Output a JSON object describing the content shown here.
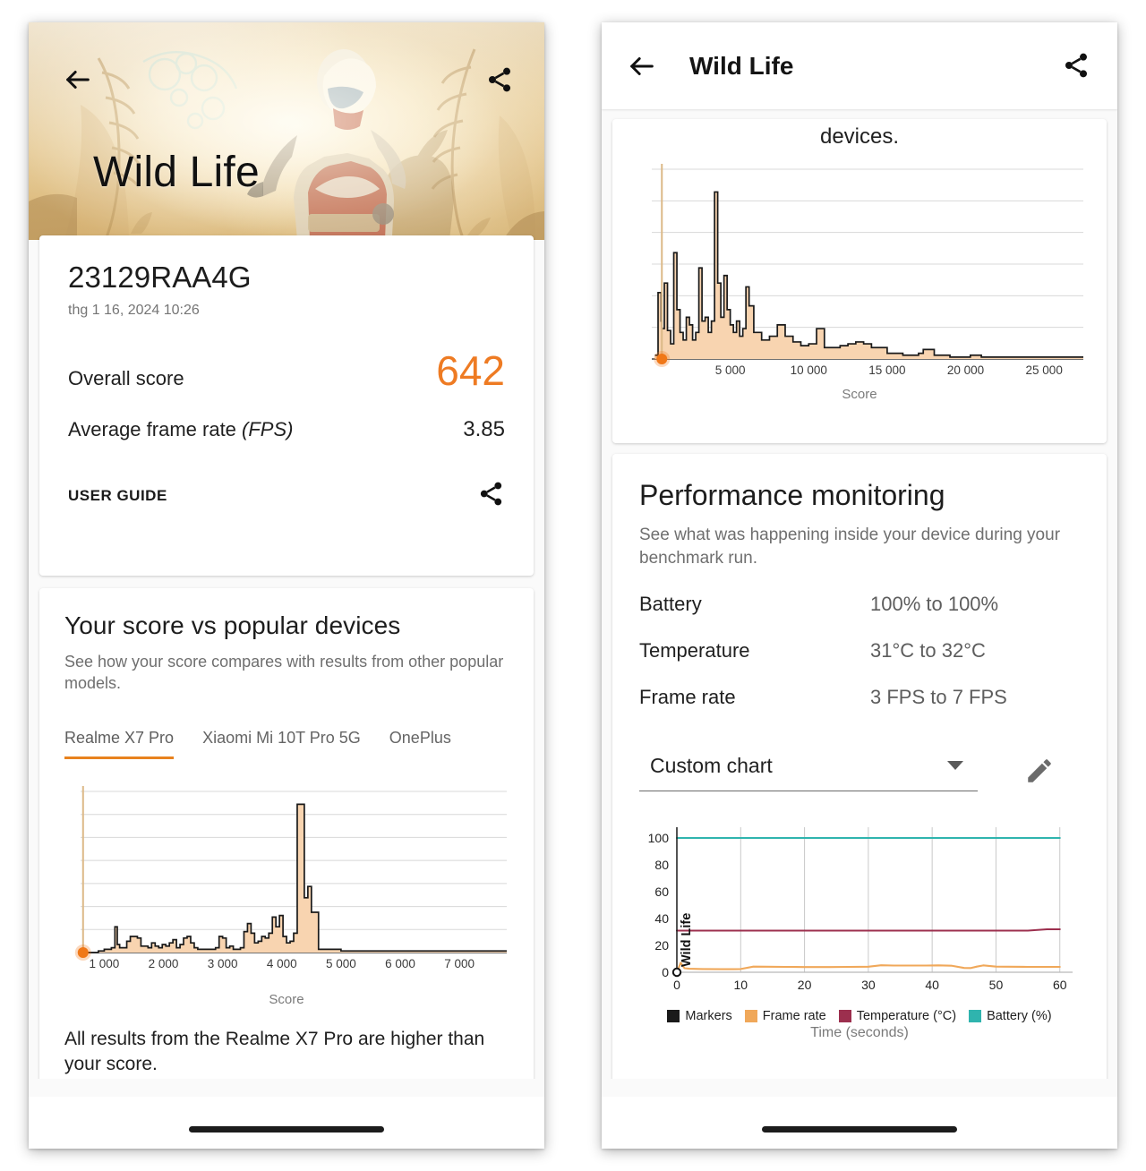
{
  "left_panel": {
    "hero": {
      "title": "Wild Life",
      "back_icon": "arrow-left-icon",
      "share_icon": "share-icon"
    },
    "score_card": {
      "device_name": "23129RAA4G",
      "timestamp": "thg 1 16, 2024 10:26",
      "overall_score_label": "Overall score",
      "overall_score_value": "642",
      "frame_rate_label_main": "Average frame rate ",
      "frame_rate_label_unit": "(FPS)",
      "frame_rate_value": "3.85",
      "user_guide_label": "USER GUIDE",
      "share_icon": "share-icon",
      "accent_color": "#ee7b23"
    },
    "compare_card": {
      "title": "Your score vs popular devices",
      "subtitle": "See how your score compares with results from other popular models.",
      "tabs": [
        {
          "label": "Realme X7 Pro",
          "active": true
        },
        {
          "label": "Xiaomi Mi 10T Pro 5G",
          "active": false
        },
        {
          "label": "OnePlus",
          "active": false
        }
      ],
      "note": "All results from the Realme X7 Pro are higher than your score."
    }
  },
  "right_panel": {
    "appbar": {
      "title": "Wild Life",
      "back_icon": "arrow-left-icon",
      "share_icon": "share-icon"
    },
    "clipped_text": "devices.",
    "performance": {
      "title": "Performance monitoring",
      "subtitle": "See what was happening inside your device during your benchmark run.",
      "rows": [
        {
          "key": "Battery",
          "value": "100% to 100%"
        },
        {
          "key": "Temperature",
          "value": "31°C to 32°C"
        },
        {
          "key": "Frame rate",
          "value": "3 FPS to 7 FPS"
        }
      ],
      "chart_select_value": "Custom chart",
      "chart_select_icon": "chevron-down-icon",
      "edit_icon": "pencil-icon"
    }
  },
  "chart_data": [
    {
      "id": "left-histogram",
      "type": "area",
      "title": "",
      "xlabel": "Score",
      "ylabel": "",
      "xlim": [
        600,
        7800
      ],
      "ylim": [
        0,
        100
      ],
      "xticks": [
        1000,
        2000,
        3000,
        4000,
        5000,
        6000,
        7000
      ],
      "xticklabels": [
        "1 000",
        "2 000",
        "3 000",
        "4 000",
        "5 000",
        "6 000",
        "7 000"
      ],
      "grid": "horizontal",
      "gridline_count": 7,
      "line_color": "#1a1a1a",
      "fill_color": "#f8d4b0",
      "marker": {
        "x": 642,
        "y": 0,
        "color": "#f07818",
        "label": "your score"
      },
      "marker_line_color": "#dcb988",
      "x": [
        640,
        700,
        800,
        900,
        1000,
        1060,
        1120,
        1180,
        1220,
        1260,
        1320,
        1380,
        1440,
        1500,
        1560,
        1620,
        1680,
        1740,
        1800,
        1860,
        1920,
        1980,
        2040,
        2100,
        2160,
        2220,
        2280,
        2340,
        2400,
        2460,
        2520,
        2580,
        2640,
        2700,
        2760,
        2820,
        2880,
        2940,
        3000,
        3060,
        3120,
        3180,
        3240,
        3300,
        3360,
        3420,
        3480,
        3540,
        3600,
        3660,
        3720,
        3780,
        3840,
        3900,
        3960,
        4020,
        4080,
        4140,
        4200,
        4260,
        4320,
        4380,
        4440,
        4500,
        4560,
        4620,
        5000,
        5500,
        6000,
        6500,
        7000,
        7500,
        7800
      ],
      "y": [
        0,
        0,
        0,
        1,
        2,
        2,
        3,
        16,
        5,
        3,
        3,
        7,
        10,
        10,
        9,
        4,
        4,
        3,
        6,
        4,
        3,
        5,
        4,
        6,
        8,
        3,
        5,
        9,
        10,
        6,
        3,
        2,
        2,
        2,
        2,
        2,
        3,
        10,
        9,
        3,
        4,
        2,
        2,
        3,
        13,
        18,
        12,
        6,
        7,
        10,
        9,
        12,
        22,
        16,
        23,
        10,
        6,
        7,
        12,
        92,
        92,
        34,
        41,
        25,
        25,
        2,
        1,
        1,
        1,
        1,
        1,
        1,
        1
      ]
    },
    {
      "id": "right-histogram",
      "type": "area",
      "title": "",
      "xlabel": "Score",
      "ylabel": "",
      "xlim": [
        0,
        27500
      ],
      "ylim": [
        0,
        100
      ],
      "xticks": [
        5000,
        10000,
        15000,
        20000,
        25000
      ],
      "xticklabels": [
        "5 000",
        "10 000",
        "15 000",
        "20 000",
        "25 000"
      ],
      "grid": "horizontal",
      "gridline_count": 6,
      "line_color": "#1a1a1a",
      "fill_color": "#f8d4b0",
      "marker": {
        "x": 642,
        "y": 0,
        "color": "#f07818",
        "label": "your score"
      },
      "marker_line_color": "#dcb988",
      "x": [
        200,
        400,
        600,
        642,
        800,
        1000,
        1200,
        1400,
        1600,
        1800,
        2000,
        2200,
        2400,
        2600,
        2800,
        3000,
        3200,
        3400,
        3600,
        3800,
        4000,
        4200,
        4400,
        4600,
        4800,
        5000,
        5200,
        5400,
        5600,
        5800,
        6000,
        6200,
        6500,
        7000,
        7500,
        8000,
        8500,
        9000,
        9500,
        10000,
        10500,
        11000,
        11500,
        12000,
        12500,
        13000,
        13500,
        14000,
        15000,
        16000,
        17000,
        17300,
        18000,
        19000,
        20000,
        20300,
        21000,
        23000,
        25000,
        27000,
        27500
      ],
      "y": [
        2,
        35,
        20,
        16,
        40,
        15,
        8,
        56,
        26,
        14,
        10,
        22,
        18,
        10,
        14,
        48,
        20,
        22,
        14,
        20,
        88,
        40,
        22,
        44,
        26,
        18,
        14,
        20,
        12,
        16,
        38,
        28,
        14,
        10,
        12,
        18,
        12,
        9,
        7,
        8,
        16,
        6,
        6,
        7,
        8,
        9,
        8,
        6,
        3,
        2,
        3,
        5,
        2,
        1,
        1,
        2,
        1,
        1,
        1,
        1,
        1
      ]
    },
    {
      "id": "custom-chart",
      "type": "line",
      "title": "",
      "xlabel": "Time (seconds)",
      "ylabel": "",
      "xlim": [
        0,
        62
      ],
      "ylim": [
        0,
        108
      ],
      "xticks": [
        0,
        10,
        20,
        30,
        40,
        50,
        60
      ],
      "xticklabels": [
        "0",
        "10",
        "20",
        "30",
        "40",
        "50",
        "60"
      ],
      "yticks": [
        0,
        20,
        40,
        60,
        80,
        100
      ],
      "yticklabels": [
        "0",
        "20",
        "40",
        "60",
        "80",
        "100"
      ],
      "grid": "vertical",
      "legend_position": "bottom",
      "legend": [
        {
          "name": "Markers",
          "color": "#1a1a1a"
        },
        {
          "name": "Frame rate",
          "color": "#f0a85a"
        },
        {
          "name": "Temperature (°C)",
          "color": "#9c2f4e"
        },
        {
          "name": "Battery (%)",
          "color": "#2fb4ae"
        }
      ],
      "marker_annotation": {
        "label": "Wild Life",
        "x": 0,
        "y": 0
      },
      "series": [
        {
          "name": "Battery (%)",
          "color": "#2fb4ae",
          "x": [
            0,
            10,
            20,
            30,
            40,
            50,
            60
          ],
          "values": [
            100,
            100,
            100,
            100,
            100,
            100,
            100
          ]
        },
        {
          "name": "Temperature (°C)",
          "color": "#9c2f4e",
          "x": [
            0,
            5,
            10,
            20,
            30,
            40,
            50,
            55,
            58,
            60
          ],
          "values": [
            31,
            31,
            31,
            31,
            31,
            31,
            31,
            31,
            32,
            32
          ]
        },
        {
          "name": "Frame rate",
          "color": "#f0a85a",
          "x": [
            0,
            0.6,
            1.2,
            2,
            4,
            7,
            9,
            10,
            12,
            14,
            17,
            20,
            24,
            27,
            30,
            32,
            34,
            36,
            39,
            41,
            43,
            45,
            46,
            47,
            48,
            50,
            52,
            55,
            58,
            60
          ],
          "values": [
            0,
            7,
            3,
            2.6,
            2.4,
            2.3,
            2.3,
            2.4,
            4.2,
            4.1,
            4.0,
            3.9,
            3.9,
            4.0,
            4.1,
            5.2,
            5.0,
            5.0,
            5.0,
            5.1,
            4.9,
            3.2,
            3.1,
            4.2,
            5.1,
            4.2,
            4.1,
            4.0,
            4.0,
            4.0
          ]
        }
      ]
    }
  ]
}
